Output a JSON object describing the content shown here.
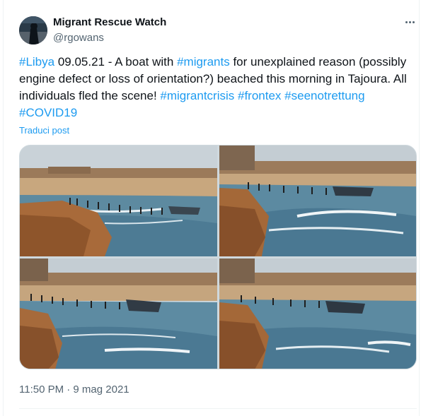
{
  "author": {
    "display_name": "Migrant Rescue Watch",
    "handle": "@rgowans"
  },
  "tweet": {
    "segments": [
      {
        "text": "#Libya",
        "type": "hashtag"
      },
      {
        "text": " 09.05.21 - A boat with ",
        "type": "text"
      },
      {
        "text": "#migrants",
        "type": "hashtag"
      },
      {
        "text": " for unexplained reason (possibly engine defect or loss of orientation?) beached this morning in Tajoura. All individuals fled the scene! ",
        "type": "text"
      },
      {
        "text": "#migrantcrisis",
        "type": "hashtag"
      },
      {
        "text": " ",
        "type": "text"
      },
      {
        "text": "#frontex",
        "type": "hashtag"
      },
      {
        "text": " ",
        "type": "text"
      },
      {
        "text": "#seenotrettung",
        "type": "hashtag"
      },
      {
        "text": " ",
        "type": "text"
      },
      {
        "text": "#COVID19",
        "type": "hashtag"
      }
    ],
    "translate_label": "Traduci post",
    "timestamp": "11:50 PM · 9 mag 2021"
  },
  "media": {
    "photo_count": 4,
    "icons": [
      "more-options-icon"
    ]
  },
  "colors": {
    "link": "#1d9bf0",
    "text": "#0f1419",
    "secondary": "#536471"
  }
}
